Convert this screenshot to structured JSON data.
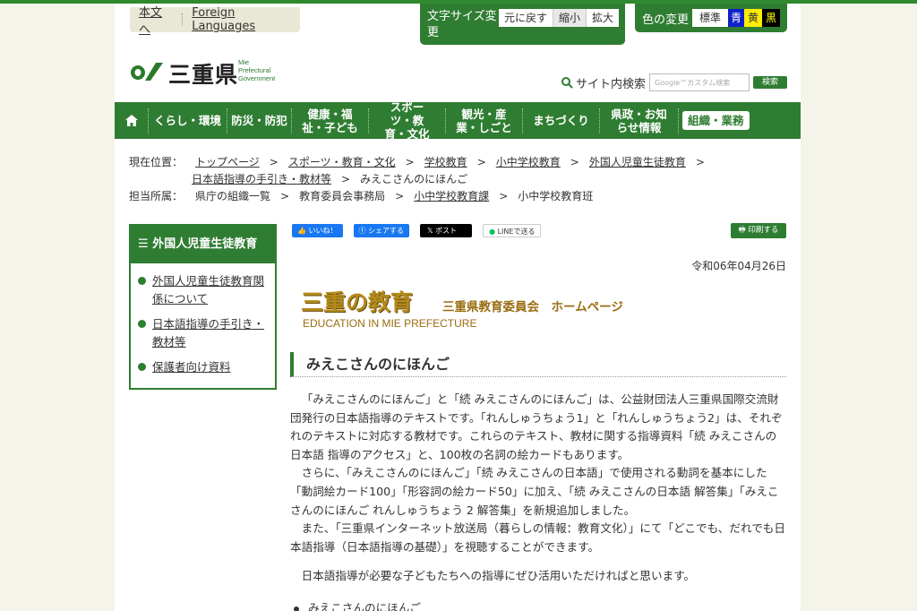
{
  "topbar": {
    "skip": "本文へ",
    "foreign": "Foreign Languages"
  },
  "fontsize": {
    "label": "文字サイズ変更",
    "reset": "元に戻す",
    "smaller": "縮小",
    "larger": "拡大"
  },
  "color": {
    "label": "色の変更",
    "standard": "標準",
    "blue": "青",
    "yellow": "黄",
    "black": "黒"
  },
  "logo": {
    "text": "三重県",
    "sub1": "Mie",
    "sub2": "Prefectural",
    "sub3": "Government"
  },
  "search": {
    "label": "サイト内検索",
    "placeholder": "Google™カスタム検索",
    "button": "検索"
  },
  "nav": {
    "items": [
      "くらし・環境",
      "防災・防犯",
      "健康・福祉・子ども",
      "スポーツ・教育・文化",
      "観光・産業・しごと",
      "まちづくり",
      "県政・お知らせ情報"
    ],
    "active": "組織・業務"
  },
  "crumb": {
    "label": "現在位置：",
    "items": [
      "トップページ",
      "スポーツ・教育・文化",
      "学校教育",
      "小中学校教育",
      "外国人児童生徒教育",
      "日本語指導の手引き・教材等",
      "みえこさんのにほんご"
    ],
    "dept_label": "担当所属：",
    "dept": [
      "県庁の組織一覧",
      "教育委員会事務局",
      "小中学校教育課",
      "小中学校教育班"
    ]
  },
  "sidebar": {
    "title": "外国人児童生徒教育",
    "items": [
      "外国人児童生徒教育関係について",
      "日本語指導の手引き・教材等",
      "保護者向け資料"
    ]
  },
  "social": {
    "like": "いいね！",
    "share": "シェアする",
    "post": "ポスト",
    "line": "LINEで送る",
    "print": "印刷する"
  },
  "date": "令和06年04月26日",
  "banner": {
    "title": "三重の教育",
    "subtitle": "三重県教育委員会　ホームページ",
    "english": "EDUCATION IN MIE PREFECTURE"
  },
  "heading": "みえこさんのにほんご",
  "body": {
    "p1": "「みえこさんのにほんご」と「続 みえこさんのにほんご」は、公益財団法人三重県国際交流財団発行の日本語指導のテキストです。「れんしゅうちょう1」と「れんしゅうちょう2」は、それぞれのテキストに対応する教材です。これらのテキスト、教材に関する指導資料「続 みえこさんの日本語 指導のアクセス」と、100枚の名詞の絵カードもあります。",
    "p2": "さらに、「みえこさんのにほんご」「続 みえこさんの日本語」で使用される動詞を基本にした「動詞絵カード100」「形容詞の絵カード50」に加え、「続 みえこさんの日本語 解答集」「みえこさんのにほんご れんしゅうちょう 2 解答集」を新規追加しました。",
    "p3": "また、「三重県インターネット放送局（暮らしの情報：教育文化）」にて「どこでも、だれでも日本語指導（日本語指導の基礎）」を視聴することができます。",
    "p4": "日本語指導が必要な子どもたちへの指導にぜひ活用いただければと思います。"
  },
  "list": {
    "first": "みえこさんのにほんご"
  }
}
